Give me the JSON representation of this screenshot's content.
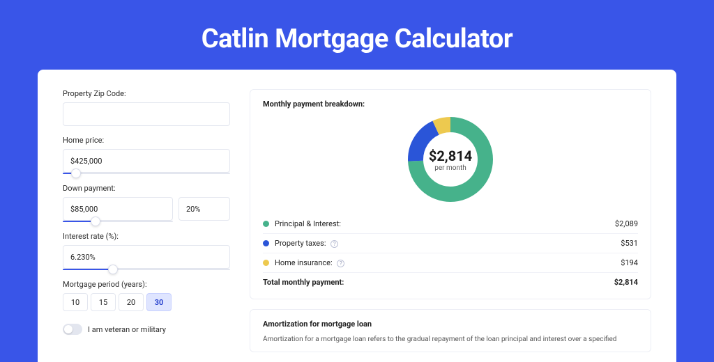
{
  "title": "Catlin Mortgage Calculator",
  "form": {
    "zip_label": "Property Zip Code:",
    "zip_value": "",
    "price_label": "Home price:",
    "price_value": "$425,000",
    "price_slider_pct": 8,
    "down_label": "Down payment:",
    "down_value": "$85,000",
    "down_pct_value": "20%",
    "down_slider_pct": 20,
    "rate_label": "Interest rate (%):",
    "rate_value": "6.230%",
    "rate_slider_pct": 30,
    "period_label": "Mortgage period (years):",
    "periods": [
      "10",
      "15",
      "20",
      "30"
    ],
    "period_selected": "30",
    "veteran_label": "I am veteran or military",
    "veteran_on": false
  },
  "breakdown": {
    "title": "Monthly payment breakdown:",
    "center_value": "$2,814",
    "center_sub": "per month",
    "rows": [
      {
        "label": "Principal & Interest:",
        "value": "$2,089",
        "color": "#46b28b",
        "info": false
      },
      {
        "label": "Property taxes:",
        "value": "$531",
        "color": "#2a55d8",
        "info": true
      },
      {
        "label": "Home insurance:",
        "value": "$194",
        "color": "#edc94f",
        "info": true
      }
    ],
    "total_label": "Total monthly payment:",
    "total_value": "$2,814"
  },
  "amort": {
    "title": "Amortization for mortgage loan",
    "text": "Amortization for a mortgage loan refers to the gradual repayment of the loan principal and interest over a specified"
  },
  "colors": {
    "green": "#46b28b",
    "blue": "#2a55d8",
    "yellow": "#edc94f"
  },
  "chart_data": {
    "type": "pie",
    "title": "Monthly payment breakdown",
    "series": [
      {
        "name": "Monthly payment",
        "values": [
          2089,
          531,
          194
        ]
      }
    ],
    "categories": [
      "Principal & Interest",
      "Property taxes",
      "Home insurance"
    ],
    "colors": [
      "#46b28b",
      "#2a55d8",
      "#edc94f"
    ],
    "total": 2814,
    "unit": "$"
  }
}
